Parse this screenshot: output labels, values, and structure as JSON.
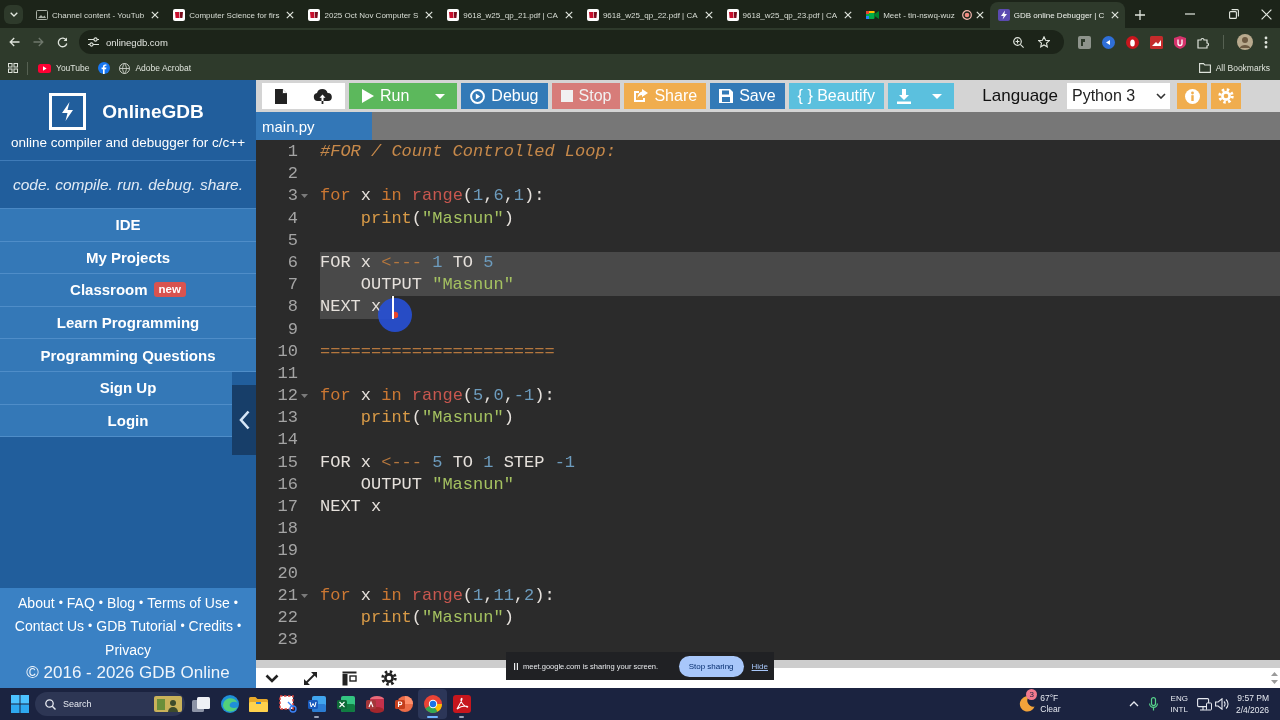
{
  "browser": {
    "tabs": [
      {
        "title": "Channel content - YouTub",
        "kind": "studio",
        "recording": false,
        "selected": false
      },
      {
        "title": "Computer Science for firs",
        "kind": "document",
        "recording": false,
        "selected": false
      },
      {
        "title": "2025 Oct Nov Computer S",
        "kind": "document",
        "recording": false,
        "selected": false
      },
      {
        "title": "9618_w25_qp_21.pdf | CA",
        "kind": "document",
        "recording": false,
        "selected": false
      },
      {
        "title": "9618_w25_qp_22.pdf | CA",
        "kind": "document",
        "recording": false,
        "selected": false
      },
      {
        "title": "9618_w25_qp_23.pdf | CA",
        "kind": "document",
        "recording": false,
        "selected": false
      },
      {
        "title": "Meet - tin-nswq-wuz",
        "kind": "meet",
        "recording": true,
        "selected": false
      },
      {
        "title": "GDB online Debugger | C",
        "kind": "gdb",
        "recording": false,
        "selected": true
      }
    ],
    "url": "onlinegdb.com",
    "bookmarks": [
      {
        "kind": "youtube",
        "label": "YouTube"
      },
      {
        "kind": "facebook"
      },
      {
        "kind": "globe",
        "label": "Adobe Acrobat"
      }
    ],
    "all_bookmarks": "All Bookmarks"
  },
  "sidebar": {
    "brand": "OnlineGDB",
    "subtitle": "online compiler and debugger for c/c++",
    "tagline": "code. compile. run. debug. share.",
    "menu": [
      {
        "label": "IDE"
      },
      {
        "label": "My Projects"
      },
      {
        "label": "Classroom",
        "badge": "new"
      },
      {
        "label": "Learn Programming"
      },
      {
        "label": "Programming Questions"
      },
      {
        "label": "Sign Up"
      },
      {
        "label": "Login"
      }
    ],
    "footer_separator": "•",
    "footer_rows": [
      [
        "About",
        "FAQ",
        "Blog",
        "Terms of Use"
      ],
      [
        "Contact Us",
        "GDB Tutorial",
        "Credits"
      ],
      [
        "Privacy"
      ]
    ],
    "copyright": "© 2016 - 2026 GDB Online"
  },
  "toolbar": {
    "buttons": [
      {
        "kind": "new-file",
        "dropdown": false,
        "disabled": false
      },
      {
        "kind": "upload",
        "dropdown": false,
        "disabled": false
      },
      {
        "kind": "run",
        "label": "Run",
        "dropdown": true,
        "disabled": false
      },
      {
        "kind": "debug",
        "label": "Debug",
        "dropdown": false,
        "disabled": false
      },
      {
        "kind": "stop",
        "label": "Stop",
        "dropdown": false,
        "disabled": true
      },
      {
        "kind": "share",
        "label": "Share",
        "dropdown": false,
        "disabled": false
      },
      {
        "kind": "save",
        "label": "Save",
        "dropdown": false,
        "disabled": false
      },
      {
        "kind": "beautify",
        "label": "{ } Beautify",
        "dropdown": false,
        "disabled": false
      },
      {
        "kind": "download",
        "dropdown": true,
        "disabled": false
      }
    ],
    "language_label": "Language",
    "language": "Python 3",
    "extra_buttons": [
      {
        "kind": "info"
      },
      {
        "kind": "settings"
      }
    ]
  },
  "file_tabs": [
    {
      "label": "main.py",
      "selected": true
    }
  ],
  "editor": {
    "lines": [
      {
        "number": "1",
        "fold": false,
        "selected": false,
        "cursor": false,
        "tokens": [
          {
            "kind": "comment",
            "text": "#FOR / Count Controlled Loop:"
          }
        ]
      },
      {
        "number": "2",
        "fold": false,
        "selected": false,
        "cursor": false
      },
      {
        "number": "3",
        "fold": true,
        "selected": false,
        "cursor": false,
        "tokens": [
          {
            "kind": "keyword",
            "text": "for"
          },
          {
            "kind": "plain",
            "text": " x "
          },
          {
            "kind": "keyword",
            "text": "in"
          },
          {
            "kind": "builtin",
            "text": " range"
          },
          {
            "kind": "plain",
            "text": "("
          },
          {
            "kind": "number",
            "text": "1"
          },
          {
            "kind": "plain",
            "text": ","
          },
          {
            "kind": "number",
            "text": "6"
          },
          {
            "kind": "plain",
            "text": ","
          },
          {
            "kind": "number",
            "text": "1"
          },
          {
            "kind": "plain",
            "text": "):"
          }
        ]
      },
      {
        "number": "4",
        "fold": false,
        "selected": false,
        "cursor": false,
        "tokens": [
          {
            "kind": "function",
            "text": "    print"
          },
          {
            "kind": "plain",
            "text": "("
          },
          {
            "kind": "string",
            "text": "\"Masnun\""
          },
          {
            "kind": "plain",
            "text": ")"
          }
        ]
      },
      {
        "number": "5",
        "fold": false,
        "selected": false,
        "cursor": false
      },
      {
        "number": "6",
        "fold": false,
        "selected": true,
        "cursor": false,
        "tokens": [
          {
            "kind": "plain",
            "text": "FOR x "
          },
          {
            "kind": "operator",
            "text": "<---"
          },
          {
            "kind": "number",
            "text": " 1"
          },
          {
            "kind": "plain",
            "text": " TO "
          },
          {
            "kind": "number",
            "text": "5"
          }
        ]
      },
      {
        "number": "7",
        "fold": false,
        "selected": true,
        "cursor": false,
        "tokens": [
          {
            "kind": "plain",
            "text": "    OUTPUT "
          },
          {
            "kind": "string",
            "text": "\"Masnun\""
          }
        ]
      },
      {
        "number": "8",
        "fold": false,
        "selected": true,
        "cursor": true,
        "tokens": [
          {
            "kind": "plain",
            "text": "NEXT x "
          }
        ]
      },
      {
        "number": "9",
        "fold": false,
        "selected": false,
        "cursor": false
      },
      {
        "number": "10",
        "fold": false,
        "selected": false,
        "cursor": false,
        "tokens": [
          {
            "kind": "operator",
            "text": "======================="
          }
        ]
      },
      {
        "number": "11",
        "fold": false,
        "selected": false,
        "cursor": false
      },
      {
        "number": "12",
        "fold": true,
        "selected": false,
        "cursor": false,
        "tokens": [
          {
            "kind": "keyword",
            "text": "for"
          },
          {
            "kind": "plain",
            "text": " x "
          },
          {
            "kind": "keyword",
            "text": "in"
          },
          {
            "kind": "builtin",
            "text": " range"
          },
          {
            "kind": "plain",
            "text": "("
          },
          {
            "kind": "number",
            "text": "5"
          },
          {
            "kind": "plain",
            "text": ","
          },
          {
            "kind": "number",
            "text": "0"
          },
          {
            "kind": "plain",
            "text": ","
          },
          {
            "kind": "number",
            "text": "-1"
          },
          {
            "kind": "plain",
            "text": "):"
          }
        ]
      },
      {
        "number": "13",
        "fold": false,
        "selected": false,
        "cursor": false,
        "tokens": [
          {
            "kind": "function",
            "text": "    print"
          },
          {
            "kind": "plain",
            "text": "("
          },
          {
            "kind": "string",
            "text": "\"Masnun\""
          },
          {
            "kind": "plain",
            "text": ")"
          }
        ]
      },
      {
        "number": "14",
        "fold": false,
        "selected": false,
        "cursor": false
      },
      {
        "number": "15",
        "fold": false,
        "selected": false,
        "cursor": false,
        "tokens": [
          {
            "kind": "plain",
            "text": "FOR x "
          },
          {
            "kind": "operator",
            "text": "<---"
          },
          {
            "kind": "number",
            "text": " 5"
          },
          {
            "kind": "plain",
            "text": " TO "
          },
          {
            "kind": "number",
            "text": "1"
          },
          {
            "kind": "plain",
            "text": " STEP "
          },
          {
            "kind": "number",
            "text": "-1"
          }
        ]
      },
      {
        "number": "16",
        "fold": false,
        "selected": false,
        "cursor": false,
        "tokens": [
          {
            "kind": "plain",
            "text": "    OUTPUT "
          },
          {
            "kind": "string",
            "text": "\"Masnun\""
          }
        ]
      },
      {
        "number": "17",
        "fold": false,
        "selected": false,
        "cursor": false,
        "tokens": [
          {
            "kind": "plain",
            "text": "NEXT x"
          }
        ]
      },
      {
        "number": "18",
        "fold": false,
        "selected": false,
        "cursor": false
      },
      {
        "number": "19",
        "fold": false,
        "selected": false,
        "cursor": false
      },
      {
        "number": "20",
        "fold": false,
        "selected": false,
        "cursor": false
      },
      {
        "number": "21",
        "fold": true,
        "selected": false,
        "cursor": false,
        "tokens": [
          {
            "kind": "keyword",
            "text": "for"
          },
          {
            "kind": "plain",
            "text": " x "
          },
          {
            "kind": "keyword",
            "text": "in"
          },
          {
            "kind": "builtin",
            "text": " range"
          },
          {
            "kind": "plain",
            "text": "("
          },
          {
            "kind": "number",
            "text": "1"
          },
          {
            "kind": "plain",
            "text": ","
          },
          {
            "kind": "number",
            "text": "11"
          },
          {
            "kind": "plain",
            "text": ","
          },
          {
            "kind": "number",
            "text": "2"
          },
          {
            "kind": "plain",
            "text": "):"
          }
        ]
      },
      {
        "number": "22",
        "fold": false,
        "selected": false,
        "cursor": false,
        "tokens": [
          {
            "kind": "function",
            "text": "    print"
          },
          {
            "kind": "plain",
            "text": "("
          },
          {
            "kind": "string",
            "text": "\"Masnun\""
          },
          {
            "kind": "plain",
            "text": ")"
          }
        ]
      },
      {
        "number": "23",
        "fold": false,
        "selected": false,
        "cursor": false
      }
    ]
  },
  "share_banner": {
    "message": "meet.google.com is sharing your screen.",
    "stop_button": "Stop sharing",
    "hide_link": "Hide"
  },
  "taskbar": {
    "search_placeholder": "Search",
    "apps": [
      {
        "kind": "taskview",
        "running": false,
        "selected": false
      },
      {
        "kind": "edge",
        "running": false,
        "selected": false
      },
      {
        "kind": "explorer",
        "running": false,
        "selected": false
      },
      {
        "kind": "snipping",
        "running": false,
        "selected": false
      },
      {
        "kind": "word",
        "running": true,
        "selected": false
      },
      {
        "kind": "excel",
        "running": false,
        "selected": false
      },
      {
        "kind": "access",
        "running": false,
        "selected": false
      },
      {
        "kind": "powerpoint",
        "running": false,
        "selected": false
      },
      {
        "kind": "chrome",
        "running": true,
        "selected": true
      },
      {
        "kind": "acrobat",
        "running": true,
        "selected": false
      }
    ],
    "weather": {
      "badge": "3",
      "temperature": "67°F",
      "condition": "Clear"
    },
    "input_language": [
      "ENG",
      "INTL"
    ],
    "time": "9:57 PM",
    "date": "2/4/2026"
  }
}
